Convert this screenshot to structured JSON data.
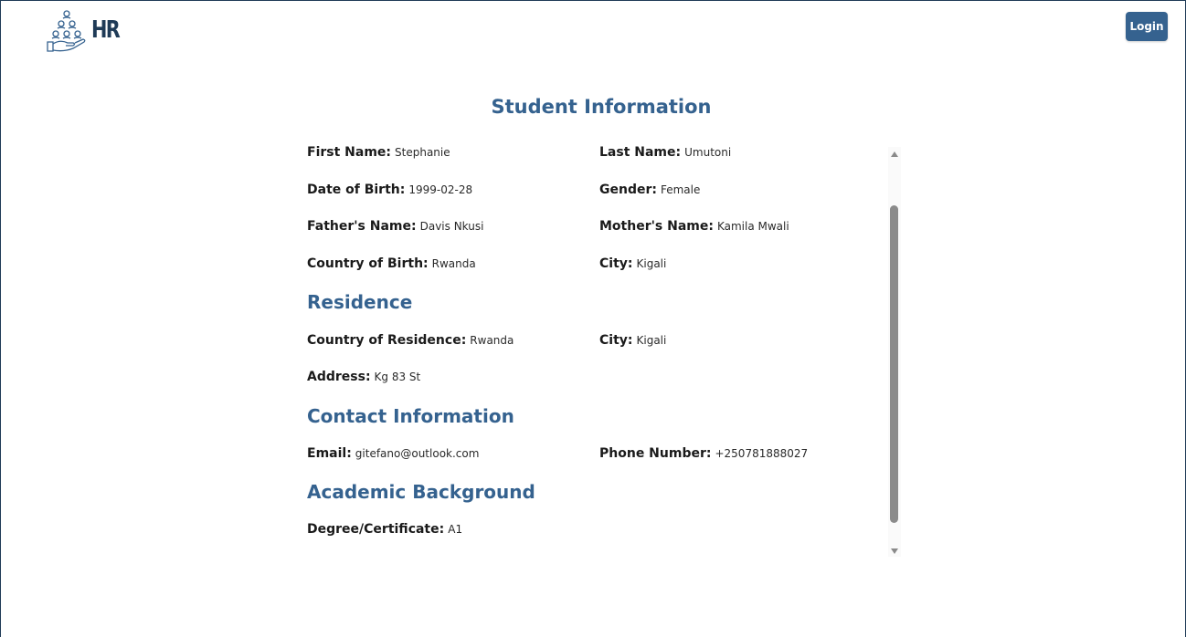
{
  "header": {
    "logo_text": "HR",
    "login_label": "Login"
  },
  "page": {
    "title": "Student Information"
  },
  "personal": {
    "first_name": {
      "label": "First Name:",
      "value": "Stephanie"
    },
    "last_name": {
      "label": "Last Name:",
      "value": "Umutoni"
    },
    "dob": {
      "label": "Date of Birth:",
      "value": "1999-02-28"
    },
    "gender": {
      "label": "Gender:",
      "value": "Female"
    },
    "father": {
      "label": "Father's Name:",
      "value": "Davis Nkusi"
    },
    "mother": {
      "label": "Mother's Name:",
      "value": "Kamila Mwali"
    },
    "country_birth": {
      "label": "Country of Birth:",
      "value": "Rwanda"
    },
    "city_birth": {
      "label": "City:",
      "value": "Kigali"
    }
  },
  "residence": {
    "title": "Residence",
    "country": {
      "label": "Country of Residence:",
      "value": "Rwanda"
    },
    "city": {
      "label": "City:",
      "value": "Kigali"
    },
    "address": {
      "label": "Address:",
      "value": "Kg 83 St"
    }
  },
  "contact": {
    "title": "Contact Information",
    "email": {
      "label": "Email:",
      "value": "gitefano@outlook.com"
    },
    "phone": {
      "label": "Phone Number:",
      "value": "+250781888027"
    }
  },
  "academic": {
    "title": "Academic Background",
    "degree": {
      "label": "Degree/Certificate:",
      "value": "A1"
    }
  },
  "colors": {
    "accent": "#35628f",
    "frame": "#1f3b57",
    "scroll_thumb": "#8b8b8b"
  },
  "icons": {
    "logo": "hand-holding-people-icon",
    "scroll_up": "triangle-up-icon",
    "scroll_down": "triangle-down-icon"
  }
}
